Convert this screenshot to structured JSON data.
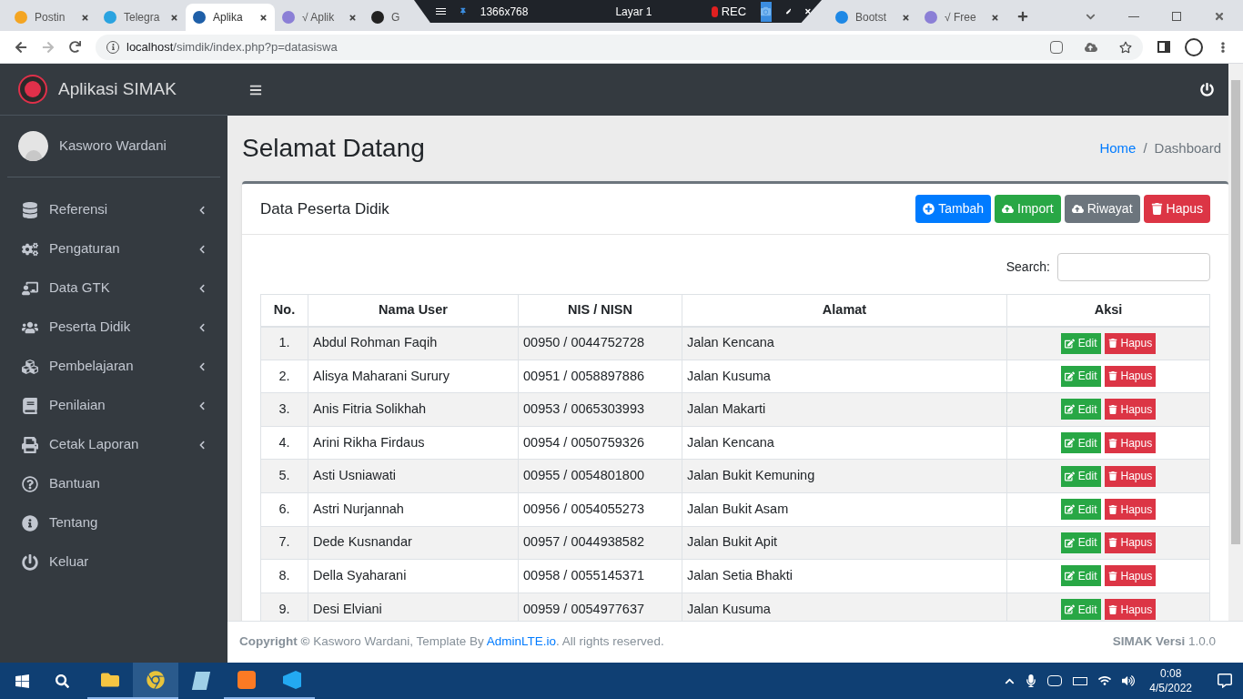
{
  "browser": {
    "tabs": [
      {
        "label": "Postin",
        "selected": false
      },
      {
        "label": "Telegra",
        "selected": false
      },
      {
        "label": "Aplika",
        "selected": true
      },
      {
        "label": "√ Aplik",
        "selected": false
      },
      {
        "label": "G",
        "selected": false
      },
      {
        "label": "Bootst",
        "selected": false
      },
      {
        "label": "√ Free",
        "selected": false
      }
    ],
    "recorder": {
      "size": "1366x768",
      "layer": "Layar 1",
      "rec": "REC"
    },
    "url_host": "localhost",
    "url_path": "/simdik/index.php?p=datasiswa"
  },
  "app": {
    "brand": "Aplikasi SIMAK",
    "user": "Kasworo Wardani",
    "menu": [
      {
        "label": "Referensi",
        "has_submenu": true
      },
      {
        "label": "Pengaturan",
        "has_submenu": true
      },
      {
        "label": "Data GTK",
        "has_submenu": true
      },
      {
        "label": "Peserta Didik",
        "has_submenu": true
      },
      {
        "label": "Pembelajaran",
        "has_submenu": true
      },
      {
        "label": "Penilaian",
        "has_submenu": true
      },
      {
        "label": "Cetak Laporan",
        "has_submenu": true
      },
      {
        "label": "Bantuan",
        "has_submenu": false
      },
      {
        "label": "Tentang",
        "has_submenu": false
      },
      {
        "label": "Keluar",
        "has_submenu": false
      }
    ],
    "page_title": "Selamat Datang",
    "breadcrumb": [
      {
        "label": "Home",
        "kind": "link"
      },
      {
        "label": "/",
        "kind": "separator"
      },
      {
        "label": "Dashboard",
        "kind": "current"
      }
    ],
    "card": {
      "title": "Data Peserta Didik",
      "buttons": [
        {
          "label": "Tambah",
          "kind": "primary"
        },
        {
          "label": "Import",
          "kind": "success"
        },
        {
          "label": "Riwayat",
          "kind": "secondary"
        },
        {
          "label": "Hapus",
          "kind": "danger"
        }
      ],
      "search_label": "Search:",
      "table": {
        "columns": [
          "No.",
          "Nama User",
          "NIS / NISN",
          "Alamat",
          "Aksi"
        ],
        "rows": [
          {
            "no": "1.",
            "name": "Abdul Rohman Faqih",
            "nis": "00950 / 0044752728",
            "alamat": "Jalan Kencana",
            "actions": [
              "Edit",
              "Hapus"
            ]
          },
          {
            "no": "2.",
            "name": "Alisya Maharani Surury",
            "nis": "00951 / 0058897886",
            "alamat": "Jalan Kusuma",
            "actions": [
              "Edit",
              "Hapus"
            ]
          },
          {
            "no": "3.",
            "name": "Anis Fitria Solikhah",
            "nis": "00953 / 0065303993",
            "alamat": "Jalan Makarti",
            "actions": [
              "Edit",
              "Hapus"
            ]
          },
          {
            "no": "4.",
            "name": "Arini Rikha Firdaus",
            "nis": "00954 / 0050759326",
            "alamat": "Jalan Kencana",
            "actions": [
              "Edit",
              "Hapus"
            ]
          },
          {
            "no": "5.",
            "name": "Asti Usniawati",
            "nis": "00955 / 0054801800",
            "alamat": "Jalan Bukit Kemuning",
            "actions": [
              "Edit",
              "Hapus"
            ]
          },
          {
            "no": "6.",
            "name": "Astri Nurjannah",
            "nis": "00956 / 0054055273",
            "alamat": "Jalan Bukit Asam",
            "actions": [
              "Edit",
              "Hapus"
            ]
          },
          {
            "no": "7.",
            "name": "Dede Kusnandar",
            "nis": "00957 / 0044938582",
            "alamat": "Jalan Bukit Apit",
            "actions": [
              "Edit",
              "Hapus"
            ]
          },
          {
            "no": "8.",
            "name": "Della Syaharani",
            "nis": "00958 / 0055145371",
            "alamat": "Jalan Setia Bhakti",
            "actions": [
              "Edit",
              "Hapus"
            ]
          },
          {
            "no": "9.",
            "name": "Desi Elviani",
            "nis": "00959 / 0054977637",
            "alamat": "Jalan Kusuma",
            "actions": [
              "Edit",
              "Hapus"
            ]
          }
        ]
      }
    },
    "footer": {
      "left": "**Copyright ©** Kasworo Wardani, Template By",
      "link": "AdminLTE.io",
      "after_link": ". All rights reserved.",
      "version": "**SIMAK Versi** 1.0.0"
    }
  },
  "taskbar": {
    "time": "0:08",
    "date": "4/5/2022"
  }
}
